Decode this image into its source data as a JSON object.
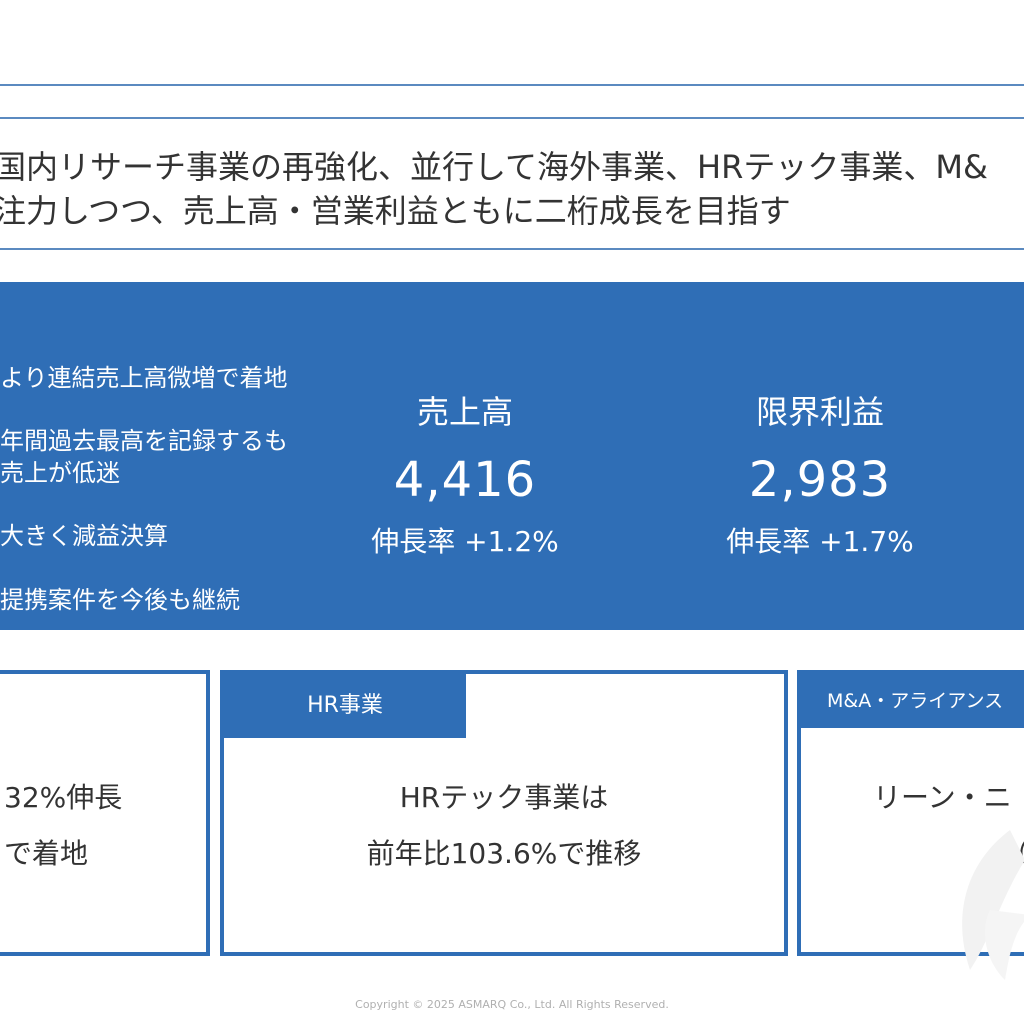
{
  "lead": {
    "line1": "国内リサーチ事業の再強化、並行して海外事業、HRテック事業、M&",
    "line2": "注力しつつ、売上高・営業利益ともに二桁成長を目指す"
  },
  "banner": {
    "bullets": [
      "より連結売上高微増で着地",
      "年間過去最高を記録するも",
      "売上が低迷",
      "大きく減益決算",
      "提携案件を今後も継続"
    ],
    "kpis": [
      {
        "label": "売上高",
        "value": "4,416",
        "rate": "伸長率 +1.2%"
      },
      {
        "label": "限界利益",
        "value": "2,983",
        "rate": "伸長率 +1.7%"
      }
    ]
  },
  "cards": {
    "left": {
      "line1": "32%伸長",
      "line2": "で着地"
    },
    "center": {
      "tab": "HR事業",
      "line1": "HRテック事業は",
      "line2": "前年比103.6%で推移"
    },
    "right": {
      "tab": "M&A・アライアンス",
      "line1": "リーン・ニ",
      "line2": "（"
    }
  },
  "colors": {
    "accent": "#2f6eb6",
    "rule": "#5b8ac0"
  },
  "footer": {
    "copyright": "Copyright © 2025 ASMARQ Co., Ltd. All Rights Reserved."
  }
}
